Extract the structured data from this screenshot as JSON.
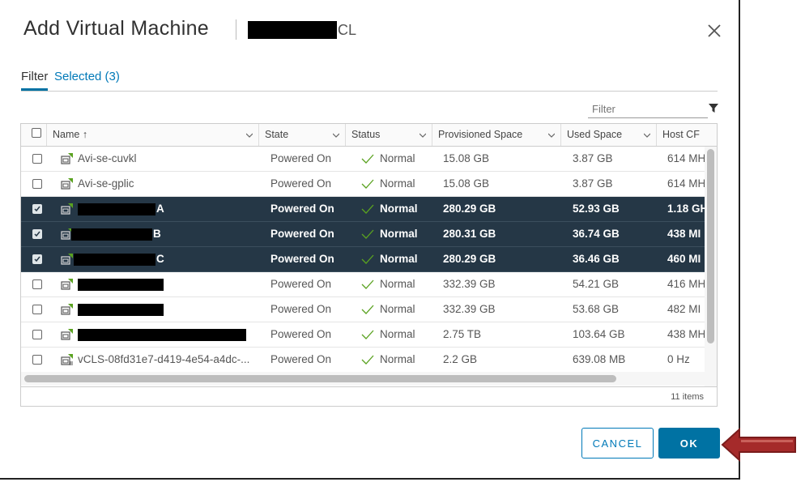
{
  "dialog": {
    "title": "Add Virtual Machine",
    "title_suffix": "CL",
    "close_icon": "close-icon"
  },
  "tabs": {
    "filter": "Filter",
    "selected": "Selected (3)"
  },
  "filter": {
    "placeholder": "Filter"
  },
  "columns": [
    {
      "label": "Name ↑"
    },
    {
      "label": "State"
    },
    {
      "label": "Status"
    },
    {
      "label": "Provisioned Space"
    },
    {
      "label": "Used Space"
    },
    {
      "label": "Host CF"
    }
  ],
  "rows": [
    {
      "name": "Avi-se-cuvkl",
      "state": "Powered On",
      "status": "Normal",
      "provisioned": "15.08 GB",
      "used": "3.87 GB",
      "host": "614 MH",
      "selected": false
    },
    {
      "name": "Avi-se-gplic",
      "state": "Powered On",
      "status": "Normal",
      "provisioned": "15.08 GB",
      "used": "3.87 GB",
      "host": "614 MH",
      "selected": false
    },
    {
      "name": "A",
      "state": "Powered On",
      "status": "Normal",
      "provisioned": "280.29 GB",
      "used": "52.93 GB",
      "host": "1.18 GH",
      "selected": true
    },
    {
      "name": "B",
      "state": "Powered On",
      "status": "Normal",
      "provisioned": "280.31 GB",
      "used": "36.74 GB",
      "host": "438 MI",
      "selected": true
    },
    {
      "name": "C",
      "state": "Powered On",
      "status": "Normal",
      "provisioned": "280.29 GB",
      "used": "36.46 GB",
      "host": "460 MI",
      "selected": true
    },
    {
      "name": "",
      "state": "Powered On",
      "status": "Normal",
      "provisioned": "332.39 GB",
      "used": "54.21 GB",
      "host": "416 MH",
      "selected": false
    },
    {
      "name": "",
      "state": "Powered On",
      "status": "Normal",
      "provisioned": "332.39 GB",
      "used": "53.68 GB",
      "host": "482 MI",
      "selected": false
    },
    {
      "name": "",
      "state": "Powered On",
      "status": "Normal",
      "provisioned": "2.75 TB",
      "used": "103.64 GB",
      "host": "438 MH",
      "selected": false
    },
    {
      "name": "vCLS-08fd31e7-d419-4e54-a4dc-...",
      "state": "Powered On",
      "status": "Normal",
      "provisioned": "2.2 GB",
      "used": "639.08 MB",
      "host": "0 Hz",
      "selected": false
    }
  ],
  "footer": {
    "items": "11 items"
  },
  "buttons": {
    "cancel": "CANCEL",
    "ok": "OK"
  },
  "colors": {
    "accent": "#0072a3",
    "selected_row": "#253746",
    "status_ok": "#5aa220",
    "annotation_arrow": "#a52a2a"
  }
}
